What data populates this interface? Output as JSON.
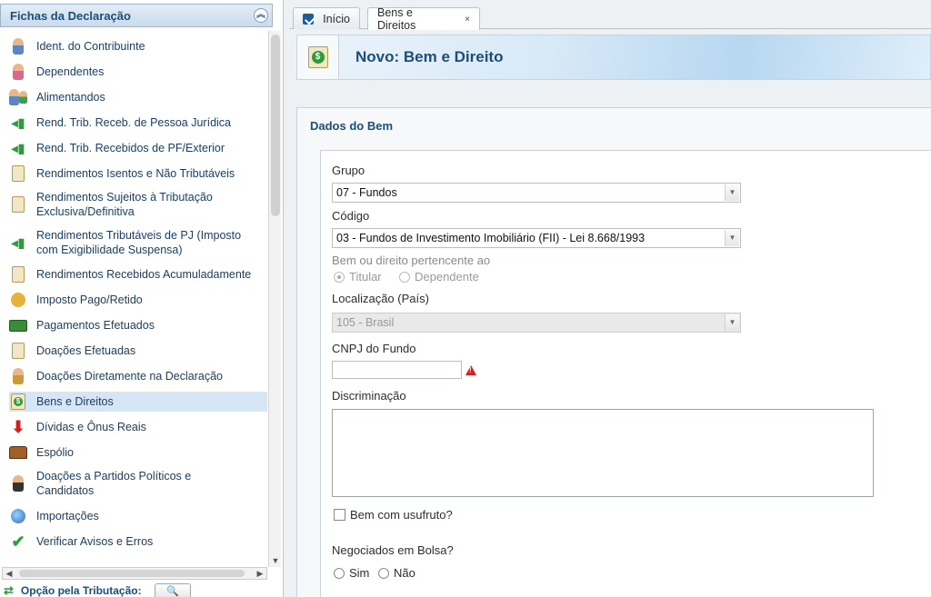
{
  "sidebar": {
    "title": "Fichas da Declaração",
    "items": [
      {
        "label": "Ident. do Contribuinte"
      },
      {
        "label": "Dependentes"
      },
      {
        "label": "Alimentandos"
      },
      {
        "label": "Rend. Trib. Receb. de Pessoa Jurídica"
      },
      {
        "label": "Rend. Trib. Recebidos de PF/Exterior"
      },
      {
        "label": "Rendimentos Isentos e Não Tributáveis"
      },
      {
        "label": "Rendimentos Sujeitos à Tributação Exclusiva/Definitiva"
      },
      {
        "label": "Rendimentos Tributáveis de PJ (Imposto com Exigibilidade Suspensa)"
      },
      {
        "label": "Rendimentos Recebidos Acumuladamente"
      },
      {
        "label": "Imposto Pago/Retido"
      },
      {
        "label": "Pagamentos Efetuados"
      },
      {
        "label": "Doações Efetuadas"
      },
      {
        "label": "Doações Diretamente na Declaração"
      },
      {
        "label": "Bens e Direitos"
      },
      {
        "label": "Dívidas e Ônus Reais"
      },
      {
        "label": "Espólio"
      },
      {
        "label": "Doações a Partidos Políticos e Candidatos"
      },
      {
        "label": "Importações"
      },
      {
        "label": "Verificar Avisos e Erros"
      }
    ],
    "active_item": "Bens e Direitos",
    "footer_label": "Opção pela Tributação:"
  },
  "tabs": [
    {
      "label": "Início"
    },
    {
      "label": "Bens e Direitos",
      "close": "×"
    }
  ],
  "page": {
    "title": "Novo: Bem e Direito"
  },
  "form": {
    "section_title": "Dados do Bem",
    "grupo": {
      "label": "Grupo",
      "value": "07 - Fundos"
    },
    "codigo": {
      "label": "Código",
      "value": "03 - Fundos de Investimento Imobiliário (FII) - Lei 8.668/1993"
    },
    "pertencente": {
      "label": "Bem ou direito pertencente ao",
      "options": [
        "Titular",
        "Dependente"
      ],
      "selected": "Titular"
    },
    "localizacao": {
      "label": "Localização (País)",
      "value": "105 - Brasil"
    },
    "cnpj": {
      "label": "CNPJ do Fundo",
      "value": ""
    },
    "discriminacao": {
      "label": "Discriminação",
      "value": ""
    },
    "usufruto": {
      "label": "Bem com usufruto?",
      "checked": false
    },
    "bolsa": {
      "label": "Negociados em Bolsa?",
      "options": [
        "Sim",
        "Não"
      ]
    }
  },
  "colors": {
    "accent": "#1d4d7a",
    "warning": "#d42020",
    "selected_row": "#d7e6f5"
  }
}
